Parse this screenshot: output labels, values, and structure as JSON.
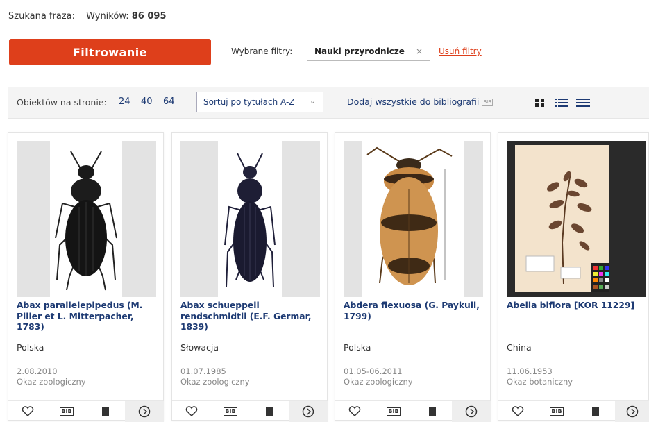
{
  "header": {
    "search_label": "Szukana fraza:",
    "results_label": "Wyników:",
    "results_count": "86 095"
  },
  "filter_button": "Filtrowanie",
  "selected_filters": {
    "label": "Wybrane filtry:",
    "chips": [
      {
        "label": "Nauki przyrodnicze",
        "remove": "×"
      }
    ],
    "clear": "Usuń filtry"
  },
  "toolbar": {
    "per_page_label": "Obiektów na stronie:",
    "per_page_options": [
      "24",
      "40",
      "64"
    ],
    "sort_value": "Sortuj po tytułach A-Z",
    "add_all": "Dodaj wszystkie do bibliografii",
    "bib_badge": "BIB",
    "view_icons": [
      "grid-view-icon",
      "list-view-icon",
      "compact-list-view-icon"
    ]
  },
  "accent_colors": {
    "brand": "#de3f1b",
    "link": "#1d3a73"
  },
  "results": [
    {
      "title": "Abax parallelepipedus (M. Piller et L. Mitterpacher, 1783)",
      "country": "Polska",
      "date": "2.08.2010",
      "kind": "Okaz zoologiczny"
    },
    {
      "title": "Abax schueppeli rendschmidtii (E.F. Germar, 1839)",
      "country": "Słowacja",
      "date": "01.07.1985",
      "kind": "Okaz zoologiczny"
    },
    {
      "title": "Abdera flexuosa (G. Paykull, 1799)",
      "country": "Polska",
      "date": "01.05-06.2011",
      "kind": "Okaz zoologiczny"
    },
    {
      "title": "Abelia biflora [KOR 11229]",
      "country": "China",
      "date": "11.06.1953",
      "kind": "Okaz botaniczny"
    }
  ],
  "card_actions": {
    "bib_label": "BIB",
    "icons": [
      "heart-icon",
      "bib-icon",
      "book-icon",
      "arrow-circle-icon"
    ]
  }
}
